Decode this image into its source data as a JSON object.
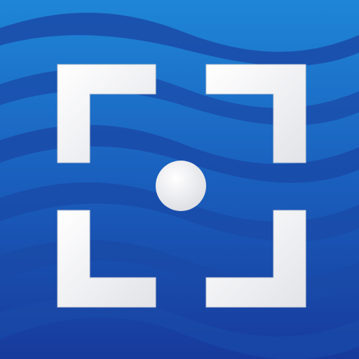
{
  "icon": {
    "name": "scanner-frame-icon",
    "colors": {
      "background_light": "#1f86d6",
      "background_mid": "#1a5fbd",
      "background_dark": "#173a9c",
      "wave_band": "#1a4aa8",
      "wave_band_light": "#2a7ed2",
      "frame": "#f1f1f3",
      "frame_shadow": "#c9ccd6",
      "dot": "#f1f1f3"
    }
  }
}
